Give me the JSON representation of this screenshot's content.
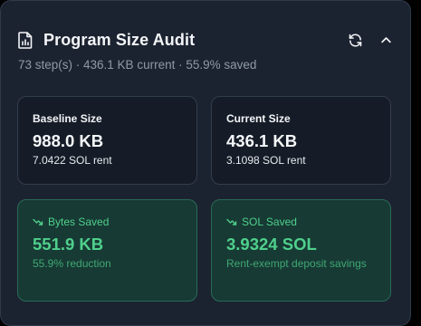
{
  "header": {
    "title": "Program Size Audit",
    "icons": [
      "document-chart-icon",
      "refresh-icon",
      "chevron-up-icon"
    ]
  },
  "subtitle": "73 step(s) · 436.1 KB current · 55.9% saved",
  "cards": [
    {
      "label": "Baseline Size",
      "value": "988.0 KB",
      "sub": "7.0422 SOL rent"
    },
    {
      "label": "Current Size",
      "value": "436.1 KB",
      "sub": "3.1098 SOL rent"
    },
    {
      "label": "Bytes Saved",
      "icon": "trend-down-icon",
      "value": "551.9 KB",
      "sub": "55.9% reduction"
    },
    {
      "label": "SOL Saved",
      "icon": "trend-down-icon",
      "value": "3.9324 SOL",
      "sub": "Rent-exempt deposit savings"
    }
  ],
  "colors": {
    "panel_bg": "#1c2330",
    "card_bg": "#161c27",
    "good_bg": "#173a34",
    "good_text": "#4fd08c"
  }
}
